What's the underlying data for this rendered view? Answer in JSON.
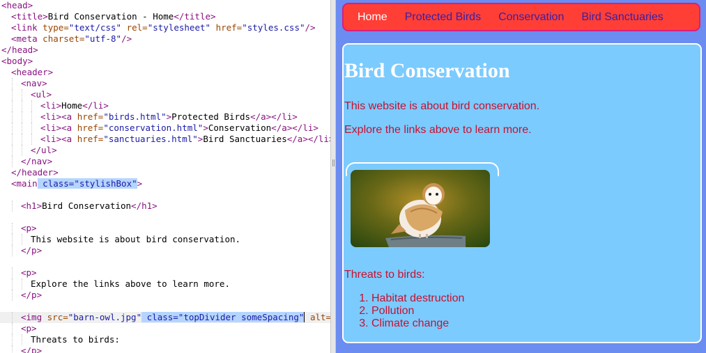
{
  "editor": {
    "lines": [
      {
        "indent": 0,
        "html": "<span class=\"tag\">&lt;head&gt;</span>"
      },
      {
        "indent": 1,
        "html": "<span class=\"tag\">&lt;title&gt;</span>Bird Conservation - Home<span class=\"tag\">&lt;/title&gt;</span>"
      },
      {
        "indent": 1,
        "html": "<span class=\"tag\">&lt;link</span> <span class=\"attr\">type=</span><span class=\"str\">\"text/css\"</span> <span class=\"attr\">rel=</span><span class=\"str\">\"stylesheet\"</span> <span class=\"attr\">href=</span><span class=\"str\">\"styles.css\"</span><span class=\"tag\">/&gt;</span>"
      },
      {
        "indent": 1,
        "html": "<span class=\"tag\">&lt;meta</span> <span class=\"attr\">charset=</span><span class=\"str\">\"utf-8\"</span><span class=\"tag\">/&gt;</span>"
      },
      {
        "indent": 0,
        "html": "<span class=\"tag\">&lt;/head&gt;</span>"
      },
      {
        "indent": 0,
        "html": "<span class=\"tag\">&lt;body&gt;</span>"
      },
      {
        "indent": 1,
        "html": "<span class=\"tag\">&lt;header&gt;</span>"
      },
      {
        "indent": 2,
        "html": "<span class=\"tag\">&lt;nav&gt;</span>"
      },
      {
        "indent": 3,
        "html": "<span class=\"tag\">&lt;ul&gt;</span>"
      },
      {
        "indent": 4,
        "html": "<span class=\"tag\">&lt;li&gt;</span>Home<span class=\"tag\">&lt;/li&gt;</span>"
      },
      {
        "indent": 4,
        "html": "<span class=\"tag\">&lt;li&gt;&lt;a</span> <span class=\"attr\">href=</span><span class=\"str\">\"birds.html\"</span><span class=\"tag\">&gt;</span>Protected Birds<span class=\"tag\">&lt;/a&gt;&lt;/li&gt;</span>"
      },
      {
        "indent": 4,
        "html": "<span class=\"tag\">&lt;li&gt;&lt;a</span> <span class=\"attr\">href=</span><span class=\"str\">\"conservation.html\"</span><span class=\"tag\">&gt;</span>Conservation<span class=\"tag\">&lt;/a&gt;&lt;/li&gt;</span>"
      },
      {
        "indent": 4,
        "html": "<span class=\"tag\">&lt;li&gt;&lt;a</span> <span class=\"attr\">href=</span><span class=\"str\">\"sanctuaries.html\"</span><span class=\"tag\">&gt;</span>Bird Sanctuaries<span class=\"tag\">&lt;/a&gt;&lt;/li&gt;</span>"
      },
      {
        "indent": 3,
        "html": "<span class=\"tag\">&lt;/ul&gt;</span>"
      },
      {
        "indent": 2,
        "html": "<span class=\"tag\">&lt;/nav&gt;</span>"
      },
      {
        "indent": 1,
        "html": "<span class=\"tag\">&lt;/header&gt;</span>"
      },
      {
        "indent": 1,
        "html": "<span class=\"tag\">&lt;main</span><span class=\"sel\"> <span class=\"attr-blue\">class=</span><span class=\"str\">\"stylishBox\"</span></span><span class=\"tag\">&gt;</span>"
      },
      {
        "indent": 0,
        "html": ""
      },
      {
        "indent": 2,
        "html": "<span class=\"tag\">&lt;h1&gt;</span>Bird Conservation<span class=\"tag\">&lt;/h1&gt;</span>"
      },
      {
        "indent": 0,
        "html": ""
      },
      {
        "indent": 2,
        "html": "<span class=\"tag\">&lt;p&gt;</span>"
      },
      {
        "indent": 3,
        "html": "This website is about bird conservation."
      },
      {
        "indent": 2,
        "html": "<span class=\"tag\">&lt;/p&gt;</span>"
      },
      {
        "indent": 0,
        "html": ""
      },
      {
        "indent": 2,
        "html": "<span class=\"tag\">&lt;p&gt;</span>"
      },
      {
        "indent": 3,
        "html": "Explore the links above to learn more."
      },
      {
        "indent": 2,
        "html": "<span class=\"tag\">&lt;/p&gt;</span>"
      },
      {
        "indent": 0,
        "html": ""
      },
      {
        "indent": 2,
        "hl": true,
        "html": "<span class=\"tag\">&lt;img</span> <span class=\"attr\">src=</span><span class=\"str\">\"barn-owl.jpg\"</span><span class=\"sel\"> <span class=\"attr-blue\">class=</span><span class=\"str\">\"topDivider someSpacing\"</span></span><span class=\"caret\"></span> <span class=\"attr\">alt=</span><span class=\"str\">\"A</span>"
      },
      {
        "indent": 2,
        "html": "<span class=\"tag\">&lt;p&gt;</span>"
      },
      {
        "indent": 3,
        "html": "Threats to birds:"
      },
      {
        "indent": 2,
        "html": "<span class=\"tag\">&lt;/p&gt;</span>"
      }
    ]
  },
  "preview": {
    "nav": {
      "home": "Home",
      "protected_birds": "Protected Birds",
      "conservation": "Conservation",
      "sanctuaries": "Bird Sanctuaries"
    },
    "heading": "Bird Conservation",
    "paragraph1": "This website is about bird conservation.",
    "paragraph2": "Explore the links above to learn more.",
    "threats_label": "Threats to birds:",
    "threats": [
      "Habitat destruction",
      "Pollution",
      "Climate change"
    ]
  }
}
